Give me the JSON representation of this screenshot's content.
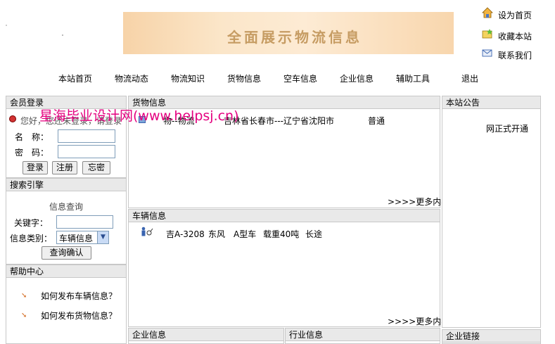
{
  "banner": {
    "text": "全面展示物流信息"
  },
  "top_links": {
    "set_home": "设为首页",
    "favorite": "收藏本站",
    "contact": "联系我们"
  },
  "nav": {
    "items": [
      "本站首页",
      "物流动态",
      "物流知识",
      "货物信息",
      "空车信息",
      "企业信息",
      "辅助工具",
      "退出"
    ]
  },
  "member": {
    "title": "会员登录",
    "greeting": "您好，您还未登录，请登录",
    "name_label": "名　称：",
    "password_label": "密　码：",
    "login_btn": "登录",
    "register_btn": "注册",
    "forgot_btn": "忘密"
  },
  "search": {
    "title": "搜索引擎",
    "subtitle": "信息查询",
    "keyword_label": "关键字：",
    "type_label": "信息类别：",
    "type_value": "车辆信息",
    "submit_btn": "查询确认"
  },
  "help": {
    "title": "帮助中心",
    "items": [
      "如何发布车辆信息？",
      "如何发布货物信息？"
    ]
  },
  "cargo": {
    "title": "货物信息",
    "row": {
      "name": "物--物流",
      "route": "吉林省长春市---辽宁省沈阳市",
      "type": "普通"
    },
    "more": ">>>>更多内容"
  },
  "vehicle": {
    "title": "车辆信息",
    "row": {
      "plate": "吉A-3208",
      "brand": "东风",
      "model": "A型车",
      "load": "载重40吨",
      "range": "长途"
    },
    "more": ">>>>更多内容"
  },
  "company": {
    "title": "企业信息"
  },
  "industry": {
    "title": "行业信息"
  },
  "notice": {
    "title": "本站公告",
    "text": "网正式开通"
  },
  "links": {
    "title": "企业链接"
  },
  "watermark": "星海毕业设计网(www.helpsj.cn)",
  "colors": {
    "panel_header": "#e9e9e9",
    "border": "#c8c8c8",
    "watermark": "#e4007f",
    "banner": "#f8d6ad"
  }
}
